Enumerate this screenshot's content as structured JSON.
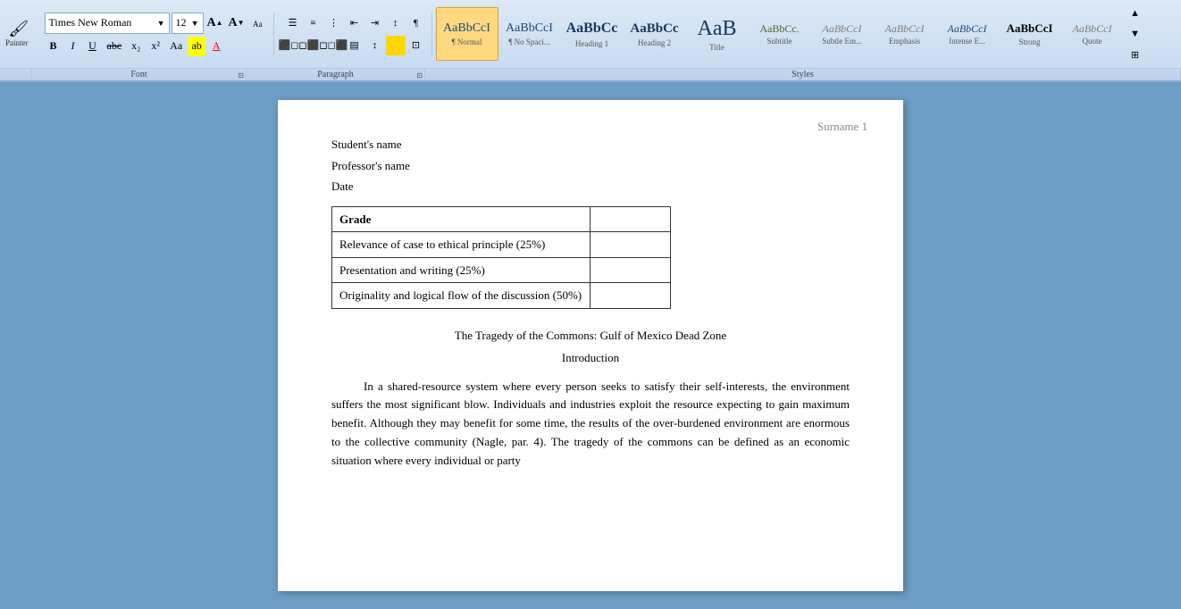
{
  "ribbon": {
    "font_family": "Times New Roman",
    "font_size": "12",
    "font_size_increase_icon": "A▲",
    "font_size_decrease_icon": "A▼",
    "clear_format_icon": "Aa",
    "bold_label": "B",
    "italic_label": "I",
    "underline_label": "U",
    "strikethrough_label": "abc",
    "subscript_label": "x₂",
    "superscript_label": "x²",
    "change_case_label": "Aa",
    "highlight_label": "ab",
    "font_color_label": "A",
    "painter_label": "Painter",
    "section_font": "Font",
    "section_paragraph": "Paragraph",
    "section_styles": "Styles"
  },
  "styles": [
    {
      "id": "normal",
      "preview": "AaBbCcI",
      "label": "¶ Normal",
      "active": true
    },
    {
      "id": "no-spacing",
      "preview": "AaBbCcI",
      "label": "¶ No Spaci...",
      "active": false
    },
    {
      "id": "heading1",
      "preview": "AaBbCc",
      "label": "Heading 1",
      "active": false
    },
    {
      "id": "heading2",
      "preview": "AaBbCc",
      "label": "Heading 2",
      "active": false
    },
    {
      "id": "title",
      "preview": "AaB",
      "label": "Title",
      "active": false
    },
    {
      "id": "subtitle",
      "preview": "AaBbCc.",
      "label": "Subtitle",
      "active": false
    },
    {
      "id": "subtle-em",
      "preview": "AaBbCcI",
      "label": "Subtle Em...",
      "active": false
    },
    {
      "id": "emphasis",
      "preview": "AaBbCcI",
      "label": "Emphasis",
      "active": false
    },
    {
      "id": "intense-e",
      "preview": "AaBbCcI",
      "label": "Intense E...",
      "active": false
    },
    {
      "id": "strong",
      "preview": "AaBbCcI",
      "label": "Strong",
      "active": false
    },
    {
      "id": "quote",
      "preview": "AaBbCcI",
      "label": "Quote",
      "active": false
    }
  ],
  "document": {
    "header_number": "Surname  1",
    "student_name": "Student's name",
    "professor_name": "Professor's name",
    "date": "Date",
    "grade_table": {
      "header": "Grade",
      "rows": [
        {
          "label": "Relevance of case to ethical principle (25%)",
          "score": ""
        },
        {
          "label": "Presentation and writing (25%)",
          "score": ""
        },
        {
          "label": "Originality and logical flow of the discussion (50%)",
          "score": ""
        }
      ]
    },
    "title": "The Tragedy of the Commons: Gulf of Mexico Dead Zone",
    "subtitle": "Introduction",
    "body": "In a shared-resource system where every person seeks to satisfy their self-interests, the environment suffers the most significant blow. Individuals and industries exploit the resource expecting to gain maximum benefit. Although they may benefit for some time, the results of the over-burdened environment are enormous to the collective community (Nagle, par. 4). The tragedy of the commons can be defined as an economic situation where every individual or party"
  }
}
